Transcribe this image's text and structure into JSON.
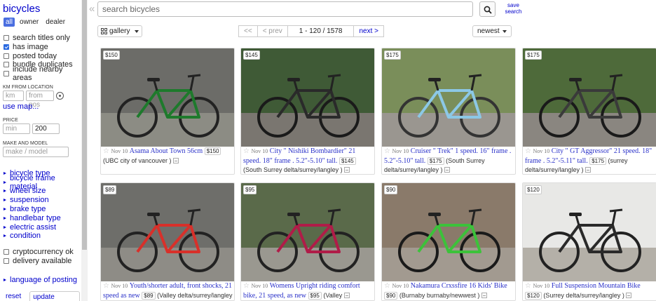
{
  "sidebar": {
    "title": "bicycles",
    "owner_tabs": [
      "all",
      "owner",
      "dealer"
    ],
    "checkboxes": [
      {
        "label": "search titles only",
        "checked": false
      },
      {
        "label": "has image",
        "checked": true
      },
      {
        "label": "posted today",
        "checked": false
      },
      {
        "label": "bundle duplicates",
        "checked": false
      },
      {
        "label": "include nearby areas",
        "checked": false
      }
    ],
    "km_label": "KM FROM LOCATION",
    "km_placeholder": "km",
    "from_pos_placeholder": "from pos",
    "use_map": "use map...",
    "price_label": "PRICE",
    "price_min_placeholder": "min",
    "price_max_value": "200",
    "make_label": "MAKE AND MODEL",
    "make_placeholder": "make / model",
    "filters": [
      "bicycle type",
      "bicycle frame material",
      "wheel size",
      "suspension",
      "brake type",
      "handlebar type",
      "electric assist",
      "condition"
    ],
    "extra_checks": [
      {
        "label": "cryptocurrency ok",
        "checked": false
      },
      {
        "label": "delivery available",
        "checked": false
      }
    ],
    "language": "language of posting",
    "reset": "reset",
    "update": "update search"
  },
  "collapse_icon": "«",
  "search": {
    "placeholder": "search bicycles",
    "save_line1": "save",
    "save_line2": "search"
  },
  "toolbar": {
    "view": "gallery",
    "first": "<<",
    "prev": "< prev",
    "range": "1 - 120 / 1578",
    "next": "next >",
    "sort": "newest"
  },
  "listings": [
    {
      "price": "$150",
      "date": "Nov 10",
      "title": "Asama About Town 56cm",
      "location": "(UBC city of vancouver )",
      "photo": {
        "bg": "#6c6c68",
        "ground": "#8c8c84",
        "frame": "#1e7a2c",
        "wheel": "#222222"
      }
    },
    {
      "price": "$145",
      "date": "Nov 10",
      "title": "City \" Nishiki Bombardier\" 21 speed. 18\" frame . 5.2\"-5.10\" tall.",
      "location": "(South Surrey delta/surrey/langley )",
      "photo": {
        "bg": "#3f5a36",
        "ground": "#7a7670",
        "frame": "#2a2a2a",
        "wheel": "#1a1a1a"
      }
    },
    {
      "price": "$175",
      "date": "Nov 10",
      "title": "Cruiser \" Trek\" 1 speed. 16\" frame . 5.2\"-5.10\" tall.",
      "location": "(South Surrey delta/surrey/langley )",
      "photo": {
        "bg": "#7a8e5a",
        "ground": "#9a9690",
        "frame": "#8cc8e6",
        "wheel": "#333333"
      }
    },
    {
      "price": "$175",
      "date": "Nov 10",
      "title": "City \" GT Aggressor\" 21 speed. 18\" frame . 5.2\"-5.11\" tall.",
      "location": "(surrey delta/surrey/langley )",
      "photo": {
        "bg": "#4e6a3a",
        "ground": "#8a8680",
        "frame": "#3a3a3a",
        "wheel": "#1a1a1a"
      }
    },
    {
      "price": "$89",
      "date": "Nov 10",
      "title": "Youth/shorter adult, front shocks, 21 speed as new",
      "location": "(Valley delta/surrey/langley )",
      "photo": {
        "bg": "#6e6e6a",
        "ground": "#8e8c86",
        "frame": "#d8302a",
        "wheel": "#222222"
      }
    },
    {
      "price": "$95",
      "date": "Nov 10",
      "title": "Womens Upright riding comfort bike, 21 speed, as new",
      "location": "(Valley",
      "photo": {
        "bg": "#5a6a4a",
        "ground": "#9a9890",
        "frame": "#b01c48",
        "wheel": "#222222"
      }
    },
    {
      "price": "$90",
      "date": "Nov 10",
      "title": "Nakamura Crxssfire 16 Kids' Bike",
      "location": "(Burnaby burnaby/newwest )",
      "photo": {
        "bg": "#8a7a6a",
        "ground": "#a29a90",
        "frame": "#3cc23a",
        "wheel": "#1a1a1a"
      }
    },
    {
      "price": "$120",
      "date": "Nov 10",
      "title": "Full Suspension Mountain Bike",
      "location": "(Surrey delta/surrey/langley )",
      "photo": {
        "bg": "#e8e8e6",
        "ground": "#b4b0a8",
        "frame": "#2a2a2a",
        "wheel": "#222222"
      }
    }
  ]
}
